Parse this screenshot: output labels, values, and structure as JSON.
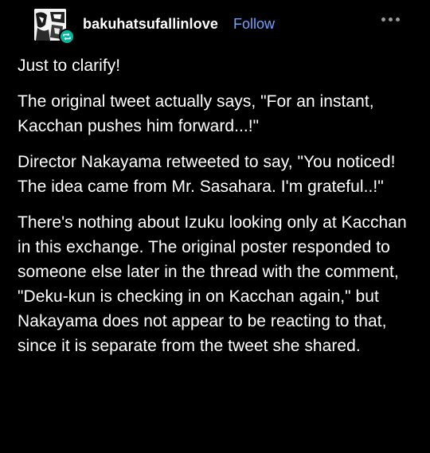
{
  "post": {
    "username": "bakuhatsufallinlove",
    "follow_label": "Follow",
    "avatar_icon": "anime-character-avatar-icon",
    "badge_icon": "reblog-badge-icon",
    "more_icon": "more-options-icon",
    "paragraphs": [
      "Just to clarify!",
      "The original tweet actually says, \"For an instant, Kacchan pushes him forward...!\"",
      "Director Nakayama retweeted to say, \"You noticed! The idea came from Mr. Sasahara. I'm grateful..!\"",
      "There's nothing about Izuku looking only at Kacchan in this exchange. The original poster responded to someone else later in the thread with the comment, \"Deku-kun is checking in on Kacchan again,\" but Nakayama does not appear to be reacting to that, since it is separate from the tweet she shared."
    ]
  },
  "colors": {
    "background": "#000000",
    "text": "#ffffff",
    "follow": "#6ea4ff",
    "badge": "#00b8a0"
  }
}
